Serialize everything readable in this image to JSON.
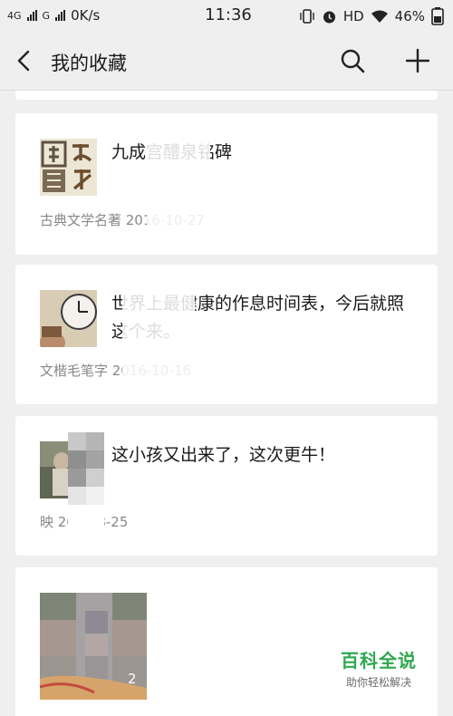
{
  "status_bar": {
    "network1": "4G",
    "network2": "G",
    "speed": "0K/s",
    "time": "11:36",
    "hd": "HD",
    "battery": "46%"
  },
  "nav": {
    "title": "我的收藏",
    "icons": [
      "back-chevron-icon",
      "search-icon",
      "plus-icon"
    ]
  },
  "favorites": [
    {
      "title": "九成宫醴泉铭碑",
      "meta": "古典文学名著 2016-10-27",
      "thumb": "calligraphy-image"
    },
    {
      "title": "世界上最健康的作息时间表，今后就照这个来。",
      "meta": "文楷毛笔字 2016-10-16",
      "thumb": "clock-image"
    },
    {
      "title": "这小孩又出来了，这次更牛！",
      "meta": "映 2016-8-25",
      "thumb": "video-image"
    },
    {
      "title": "",
      "meta": "",
      "thumb": "photo-album-image",
      "image_count": "2"
    }
  ],
  "watermark": {
    "title": "百科全说",
    "subtitle": "助你轻松解决"
  }
}
